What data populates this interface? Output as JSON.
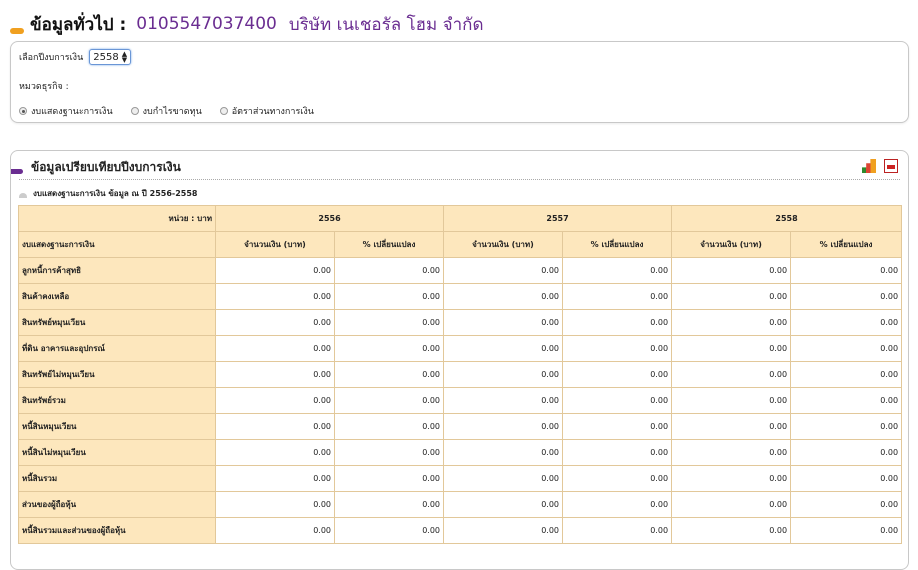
{
  "header": {
    "title": "ข้อมูลทั่วไป :",
    "registration_no": "0105547037400",
    "company_name": "บริษัท เนเชอรัล โฮม จำกัด"
  },
  "filters": {
    "year_label": "เลือกปีงบการเงิน",
    "year_value": "2558",
    "category_label": "หมวดธุรกิจ :",
    "reports": [
      {
        "label": "งบแสดงฐานะการเงิน",
        "checked": true
      },
      {
        "label": "งบกำไรขาดทุน",
        "checked": false
      },
      {
        "label": "อัตราส่วนทางการเงิน",
        "checked": false
      }
    ]
  },
  "comparison": {
    "title": "ข้อมูลเปรียบเทียบปีงบการเงิน",
    "icons": [
      "bar-chart-icon",
      "pdf-icon"
    ],
    "subtitle": "งบแสดงฐานะการเงิน ข้อมูล ณ ปี 2556-2558",
    "unit_label": "หน่วย : บาท",
    "row_header": "งบแสดงฐานะการเงิน",
    "years": [
      "2556",
      "2557",
      "2558"
    ],
    "col_amount": "จำนวนเงิน (บาท)",
    "col_change": "% เปลี่ยนแปลง",
    "rows": [
      {
        "label": "ลูกหนี้การค้าสุทธิ",
        "values": [
          "0.00",
          "0.00",
          "0.00",
          "0.00",
          "0.00",
          "0.00"
        ]
      },
      {
        "label": "สินค้าคงเหลือ",
        "values": [
          "0.00",
          "0.00",
          "0.00",
          "0.00",
          "0.00",
          "0.00"
        ]
      },
      {
        "label": "สินทรัพย์หมุนเวียน",
        "values": [
          "0.00",
          "0.00",
          "0.00",
          "0.00",
          "0.00",
          "0.00"
        ]
      },
      {
        "label": "ที่ดิน อาคารและอุปกรณ์",
        "values": [
          "0.00",
          "0.00",
          "0.00",
          "0.00",
          "0.00",
          "0.00"
        ]
      },
      {
        "label": "สินทรัพย์ไม่หมุนเวียน",
        "values": [
          "0.00",
          "0.00",
          "0.00",
          "0.00",
          "0.00",
          "0.00"
        ]
      },
      {
        "label": "สินทรัพย์รวม",
        "values": [
          "0.00",
          "0.00",
          "0.00",
          "0.00",
          "0.00",
          "0.00"
        ]
      },
      {
        "label": "หนี้สินหมุนเวียน",
        "values": [
          "0.00",
          "0.00",
          "0.00",
          "0.00",
          "0.00",
          "0.00"
        ]
      },
      {
        "label": "หนี้สินไม่หมุนเวียน",
        "values": [
          "0.00",
          "0.00",
          "0.00",
          "0.00",
          "0.00",
          "0.00"
        ]
      },
      {
        "label": "หนี้สินรวม",
        "values": [
          "0.00",
          "0.00",
          "0.00",
          "0.00",
          "0.00",
          "0.00"
        ]
      },
      {
        "label": "ส่วนของผู้ถือหุ้น",
        "values": [
          "0.00",
          "0.00",
          "0.00",
          "0.00",
          "0.00",
          "0.00"
        ]
      },
      {
        "label": "หนี้สินรวมและส่วนของผู้ถือหุ้น",
        "values": [
          "0.00",
          "0.00",
          "0.00",
          "0.00",
          "0.00",
          "0.00"
        ]
      }
    ]
  },
  "colors": {
    "accent_orange": "#f0a020",
    "brand_purple": "#6a2d91",
    "table_header": "#fde7bd"
  }
}
